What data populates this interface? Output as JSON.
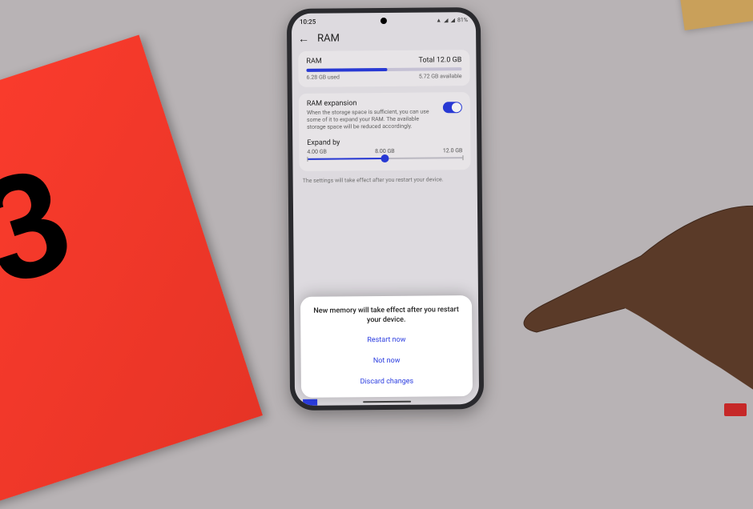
{
  "status": {
    "time": "10:25",
    "battery": "81%"
  },
  "header": {
    "title": "RAM"
  },
  "ram_card": {
    "label": "RAM",
    "total": "Total 12.0 GB",
    "used": "6.28 GB used",
    "available": "5.72 GB available"
  },
  "expansion_card": {
    "title": "RAM expansion",
    "description": "When the storage space is sufficient, you can use some of it to expand your RAM. The available storage space will be reduced accordingly.",
    "expand_by": "Expand by",
    "options": [
      "4.00 GB",
      "8.00 GB",
      "12.0 GB"
    ]
  },
  "note": "The settings will take effect after you restart your device.",
  "dialog": {
    "message": "New memory will take effect after you restart your device.",
    "restart": "Restart now",
    "not_now": "Not now",
    "discard": "Discard changes"
  }
}
